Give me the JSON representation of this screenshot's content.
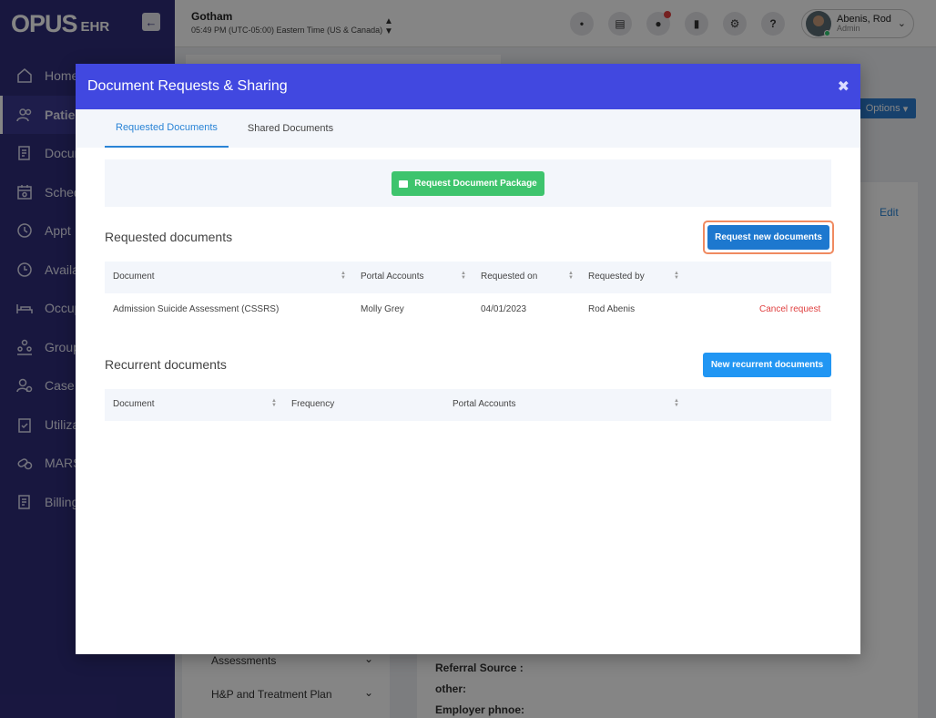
{
  "app": {
    "logo": "OPUS",
    "logo_sub": "EHR"
  },
  "sidebar": {
    "items": [
      {
        "label": "Home",
        "icon": "home-icon"
      },
      {
        "label": "Patients",
        "icon": "patients-icon"
      },
      {
        "label": "Documents",
        "icon": "documents-icon"
      },
      {
        "label": "Scheduling",
        "icon": "calendar-icon"
      },
      {
        "label": "Appt",
        "icon": "clock-icon"
      },
      {
        "label": "Availability",
        "icon": "availability-icon"
      },
      {
        "label": "Occupancy",
        "icon": "bed-icon"
      },
      {
        "label": "Groups",
        "icon": "group-icon"
      },
      {
        "label": "Case",
        "icon": "case-icon"
      },
      {
        "label": "Utilization",
        "icon": "clipboard-check-icon"
      },
      {
        "label": "MARS",
        "icon": "pills-icon"
      },
      {
        "label": "Billing",
        "icon": "billing-icon"
      }
    ]
  },
  "topbar": {
    "tenant_name": "Gotham",
    "tenant_time": "05:49 PM (UTC-05:00) Eastern Time (US & Canada)",
    "user_name": "Abenis, Rod",
    "user_role": "Admin",
    "help_glyph": "?"
  },
  "background": {
    "options_label": "Options",
    "edit_label": "Edit",
    "accordion_1": "Assessments",
    "accordion_2": "H&P and Treatment Plan",
    "referral_label": "Referral Source :",
    "other_label": "other:",
    "employer_label": "Employer phnoe:"
  },
  "modal": {
    "title": "Document Requests & Sharing",
    "close_glyph": "✖",
    "tabs": [
      {
        "label": "Requested Documents",
        "active": true
      },
      {
        "label": "Shared Documents",
        "active": false
      }
    ],
    "package_button": "Request Document Package",
    "requested": {
      "title": "Requested documents",
      "button": "Request new documents",
      "columns": [
        "Document",
        "Portal Accounts",
        "Requested on",
        "Requested by"
      ],
      "rows": [
        {
          "document": "Admission Suicide Assessment (CSSRS)",
          "portal_accounts": "Molly Grey",
          "requested_on": "04/01/2023",
          "requested_by": "Rod Abenis",
          "action": "Cancel request"
        }
      ]
    },
    "recurrent": {
      "title": "Recurrent documents",
      "button": "New recurrent documents",
      "columns": [
        "Document",
        "Frequency",
        "Portal Accounts"
      ]
    }
  },
  "colors": {
    "sidebar": "#2f2c7a",
    "modal_header": "#4148e0",
    "primary": "#2a84d6",
    "success": "#3ec46d",
    "danger": "#e04040"
  }
}
